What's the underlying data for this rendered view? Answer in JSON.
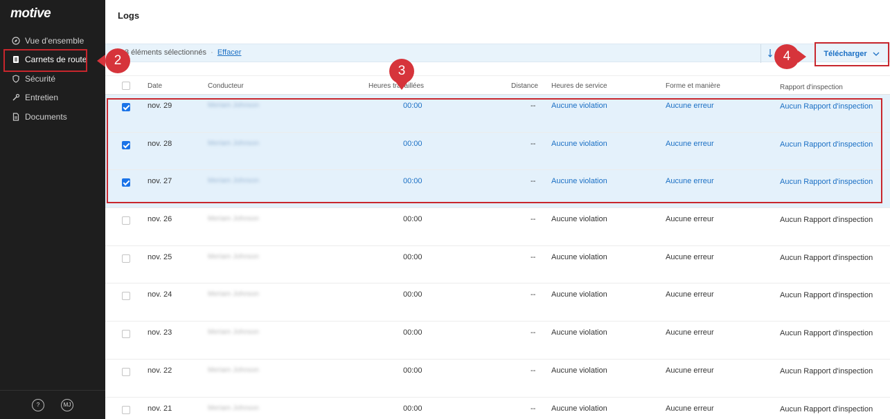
{
  "app": {
    "logo": "motive"
  },
  "sidebar": {
    "items": [
      {
        "label": "Vue d'ensemble",
        "icon": "compass-icon",
        "active": false
      },
      {
        "label": "Carnets de route",
        "icon": "logbook-icon",
        "active": true
      },
      {
        "label": "Sécurité",
        "icon": "shield-icon",
        "active": false
      },
      {
        "label": "Entretien",
        "icon": "wrench-icon",
        "active": false
      },
      {
        "label": "Documents",
        "icon": "document-icon",
        "active": false
      }
    ],
    "footer": {
      "help": "?",
      "avatar": "MJ"
    }
  },
  "page": {
    "title": "Logs"
  },
  "selection": {
    "count_text": "3 éléments sélectionnés",
    "separator": "·",
    "clear_label": "Effacer"
  },
  "toolbar": {
    "download_label": "Télécharger"
  },
  "table": {
    "headers": [
      "Date",
      "Conducteur",
      "Heures travaillées",
      "Distance",
      "Heures de service",
      "Forme et manière",
      "Rapport d'inspection"
    ],
    "rows": [
      {
        "date": "nov. 29",
        "driver": "Meriam Johnson",
        "hours": "00:00",
        "distance": "--",
        "hos": "Aucune violation",
        "form": "Aucune erreur",
        "inspection": "Aucun Rapport d'inspection",
        "selected": true
      },
      {
        "date": "nov. 28",
        "driver": "Meriam Johnson",
        "hours": "00:00",
        "distance": "--",
        "hos": "Aucune violation",
        "form": "Aucune erreur",
        "inspection": "Aucun Rapport d'inspection",
        "selected": true
      },
      {
        "date": "nov. 27",
        "driver": "Meriam Johnson",
        "hours": "00:00",
        "distance": "--",
        "hos": "Aucune violation",
        "form": "Aucune erreur",
        "inspection": "Aucun Rapport d'inspection",
        "selected": true
      },
      {
        "date": "nov. 26",
        "driver": "Meriam Johnson",
        "hours": "00:00",
        "distance": "--",
        "hos": "Aucune violation",
        "form": "Aucune erreur",
        "inspection": "Aucun Rapport d'inspection",
        "selected": false
      },
      {
        "date": "nov. 25",
        "driver": "Meriam Johnson",
        "hours": "00:00",
        "distance": "--",
        "hos": "Aucune violation",
        "form": "Aucune erreur",
        "inspection": "Aucun Rapport d'inspection",
        "selected": false
      },
      {
        "date": "nov. 24",
        "driver": "Meriam Johnson",
        "hours": "00:00",
        "distance": "--",
        "hos": "Aucune violation",
        "form": "Aucune erreur",
        "inspection": "Aucun Rapport d'inspection",
        "selected": false
      },
      {
        "date": "nov. 23",
        "driver": "Meriam Johnson",
        "hours": "00:00",
        "distance": "--",
        "hos": "Aucune violation",
        "form": "Aucune erreur",
        "inspection": "Aucun Rapport d'inspection",
        "selected": false
      },
      {
        "date": "nov. 22",
        "driver": "Meriam Johnson",
        "hours": "00:00",
        "distance": "--",
        "hos": "Aucune violation",
        "form": "Aucune erreur",
        "inspection": "Aucun Rapport d'inspection",
        "selected": false
      },
      {
        "date": "nov. 21",
        "driver": "Meriam Johnson",
        "hours": "00:00",
        "distance": "--",
        "hos": "Aucune violation",
        "form": "Aucune erreur",
        "inspection": "Aucun Rapport d'inspection",
        "selected": false
      }
    ]
  },
  "annotations": {
    "badge_2": "2",
    "badge_3": "3",
    "badge_4": "4",
    "color": "#d6343b"
  }
}
